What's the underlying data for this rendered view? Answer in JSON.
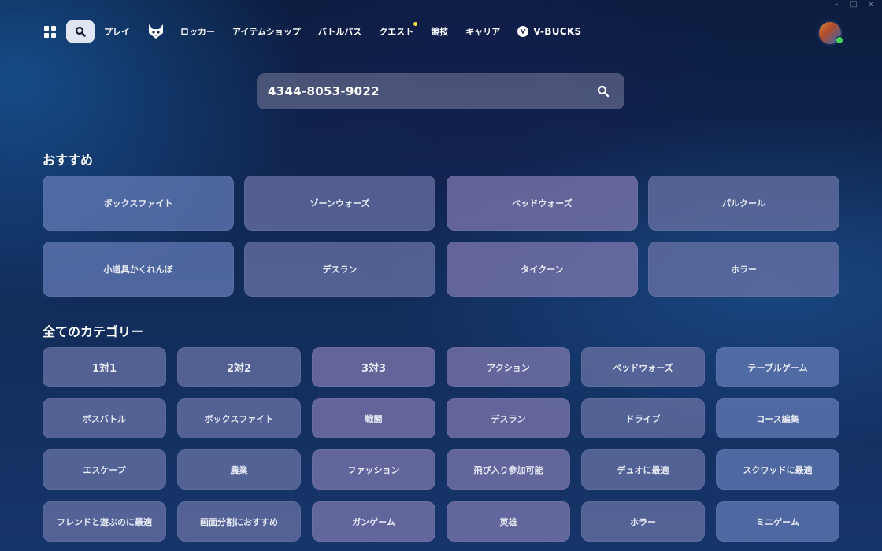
{
  "window_controls": [
    "–",
    "□",
    "×"
  ],
  "nav": {
    "items": [
      {
        "label": "プレイ"
      },
      {
        "label": "ロッカー"
      },
      {
        "label": "アイテムショップ"
      },
      {
        "label": "バトルパス"
      },
      {
        "label": "クエスト",
        "has_notification": true
      },
      {
        "label": "競技"
      },
      {
        "label": "キャリア"
      }
    ],
    "vbucks_label": "V-BUCKS",
    "notification_color": "#f5e04a",
    "online_color": "#47d65a"
  },
  "search": {
    "value": "4344-8053-9022",
    "icon": "search-icon"
  },
  "featured": {
    "title": "おすすめ",
    "tiles": [
      "ボックスファイト",
      "ゾーンウォーズ",
      "ベッドウォーズ",
      "パルクール",
      "小道具かくれんぼ",
      "デスラン",
      "タイクーン",
      "ホラー"
    ]
  },
  "categories": {
    "title": "全てのカテゴリー",
    "tiles": [
      "1対1",
      "2対2",
      "3対3",
      "アクション",
      "ベッドウォーズ",
      "テーブルゲーム",
      "ボスバトル",
      "ボックスファイト",
      "戦闘",
      "デスラン",
      "ドライブ",
      "コース編集",
      "エスケープ",
      "農業",
      "ファッション",
      "飛び入り参加可能",
      "デュオに最適",
      "スクワッドに最適",
      "フレンドと遊ぶのに最適",
      "画面分割におすすめ",
      "ガンゲーム",
      "英雄",
      "ホラー",
      "ミニゲーム"
    ]
  }
}
